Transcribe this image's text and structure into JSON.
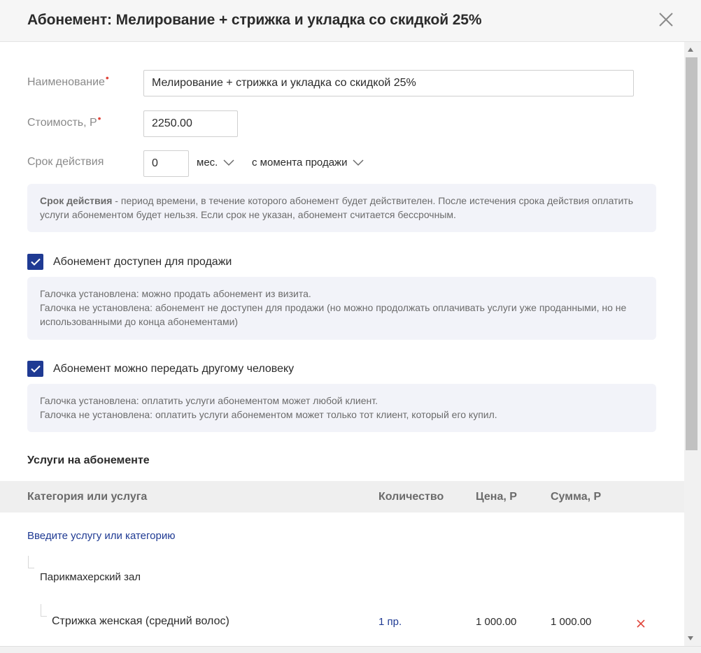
{
  "header": {
    "title": "Абонемент: Мелирование + стрижка и укладка со скидкой 25%"
  },
  "form": {
    "name_label": "Наименование",
    "name_value": "Мелирование + стрижка и укладка со скидкой 25%",
    "cost_label": "Стоимость, Р",
    "cost_value": "2250.00",
    "required_mark": "•",
    "validity_label": "Срок действия",
    "validity_value": "0",
    "unit_dropdown": "мес.",
    "start_dropdown": "с момента продажи"
  },
  "info_validity": {
    "bold": "Срок действия",
    "text": " - период времени, в течение которого абонемент будет действителен. После истечения срока действия оплатить услуги абонементом будет нельзя. Если срок не указан, абонемент считается бессрочным."
  },
  "checkbox_sale": {
    "label": "Абонемент доступен для продажи",
    "checked": true
  },
  "info_sale": {
    "line1": "Галочка установлена: можно продать абонемент из визита.",
    "line2": "Галочка не установлена: абонемент не доступен для продажи (но можно продолжать оплачивать услуги уже проданными, но не использованными до конца абонементами)"
  },
  "checkbox_transfer": {
    "label": "Абонемент можно передать другому человеку",
    "checked": true
  },
  "info_transfer": {
    "line1": "Галочка установлена: оплатить услуги абонементом может любой клиент.",
    "line2": "Галочка не установлена: оплатить услуги абонементом может только тот клиент, который его купил."
  },
  "services": {
    "title": "Услуги на абонементе",
    "columns": [
      "Категория или услуга",
      "Количество",
      "Цена, Р",
      "Сумма, Р"
    ],
    "add_link": "Введите услугу или категорию",
    "category": "Парикмахерский зал",
    "rows": [
      {
        "name": "Стрижка женская (средний волос)",
        "qty": "1 пр.",
        "price": "1 000.00",
        "sum": "1 000.00"
      }
    ]
  },
  "colors": {
    "accent": "#1f3a93",
    "danger": "#e0443a",
    "info_bg": "#f2f3f9"
  },
  "icons": {
    "close": "close-icon",
    "chevron": "chevron-down-icon",
    "check": "check-icon",
    "delete": "delete-x-icon"
  }
}
